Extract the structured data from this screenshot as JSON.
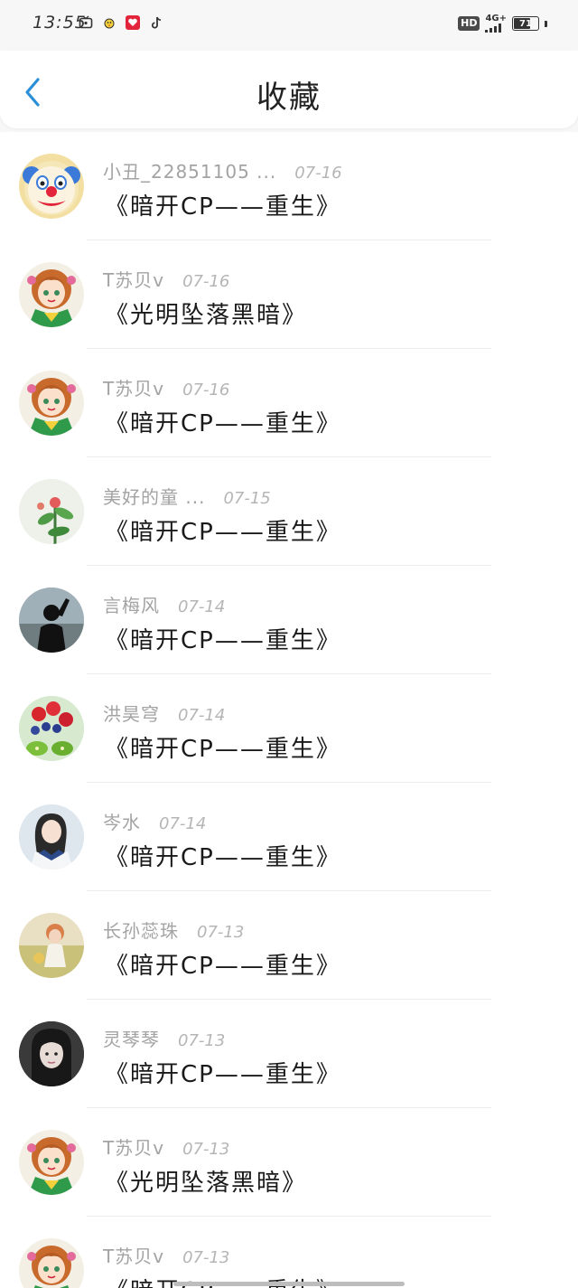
{
  "status_bar": {
    "time": "13:55",
    "hd": "HD",
    "network": "4G+",
    "battery": "71"
  },
  "header": {
    "title": "收藏"
  },
  "items": [
    {
      "user": "小丑_22851105 ...",
      "date": "07-16",
      "title": "《暗开CP——重生》",
      "avatar": "clown"
    },
    {
      "user": "T苏贝v",
      "date": "07-16",
      "title": "《光明坠落黑暗》",
      "avatar": "anime-girl"
    },
    {
      "user": "T苏贝v",
      "date": "07-16",
      "title": "《暗开CP——重生》",
      "avatar": "anime-girl"
    },
    {
      "user": "美好的童 ...",
      "date": "07-15",
      "title": "《暗开CP——重生》",
      "avatar": "plant"
    },
    {
      "user": "言梅风",
      "date": "07-14",
      "title": "《暗开CP——重生》",
      "avatar": "silhouette"
    },
    {
      "user": "洪昊穹",
      "date": "07-14",
      "title": "《暗开CP——重生》",
      "avatar": "fruit"
    },
    {
      "user": "岑水",
      "date": "07-14",
      "title": "《暗开CP——重生》",
      "avatar": "girl-uniform"
    },
    {
      "user": "长孙蕊珠",
      "date": "07-13",
      "title": "《暗开CP——重生》",
      "avatar": "field-girl"
    },
    {
      "user": "灵琴琴",
      "date": "07-13",
      "title": "《暗开CP——重生》",
      "avatar": "dark-girl"
    },
    {
      "user": "T苏贝v",
      "date": "07-13",
      "title": "《光明坠落黑暗》",
      "avatar": "anime-girl"
    },
    {
      "user": "T苏贝v",
      "date": "07-13",
      "title": "《暗开CP——重生》",
      "avatar": "anime-girl"
    }
  ],
  "colors": {
    "accent": "#2a8fd8",
    "background": "#f7f7f7",
    "title_text": "#1a1a1a",
    "meta_text": "#a3a3a3"
  }
}
